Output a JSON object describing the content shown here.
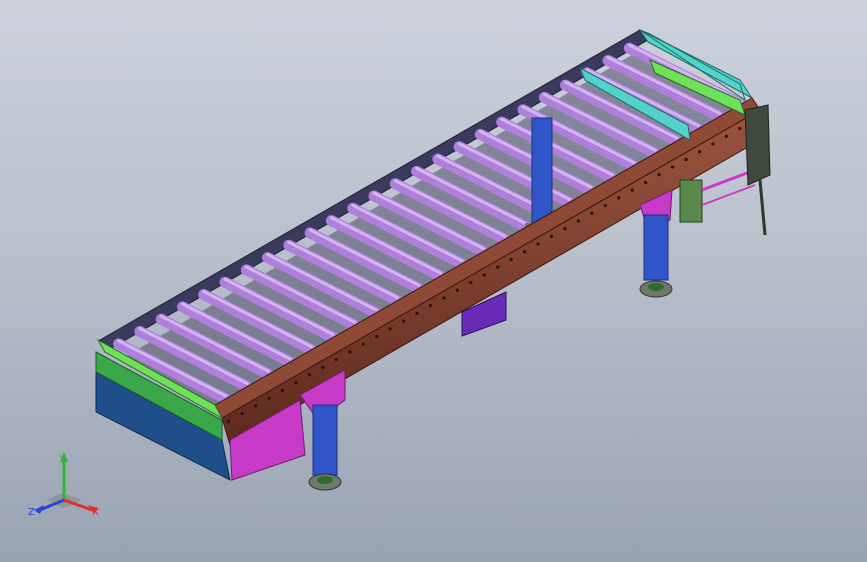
{
  "viewport": {
    "background_top": "#cdd2db",
    "background_bottom": "#9aa3b3"
  },
  "model": {
    "roller_count": 25,
    "colors": {
      "roller": "#b07fdc",
      "roller_highlight": "#d3b6f1",
      "roller_shadow": "#7f4fb0",
      "side_rail": "#7a3a2a",
      "side_rail_top": "#8e4a36",
      "back_rail": "#3a3a5c",
      "leg": "#2f55c8",
      "leg_dark": "#1b2f80",
      "foot": "#6d7a6a",
      "end_green": "#6ee05a",
      "end_blue": "#1f4f8a",
      "magenta": "#c83ac8",
      "cyan": "#52d2c8",
      "guard_purple": "#6a2ab8"
    }
  },
  "triad": {
    "x_label": "X",
    "y_label": "Y",
    "z_label": "Z",
    "x_color": "#e0302a",
    "y_color": "#2fb53a",
    "z_color": "#2a44d8"
  }
}
